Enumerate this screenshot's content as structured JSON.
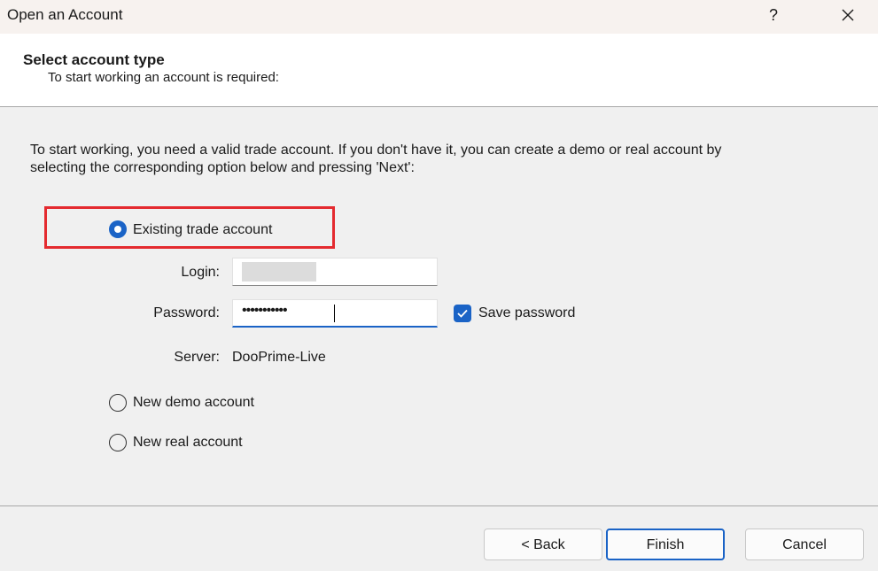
{
  "window": {
    "title": "Open an Account",
    "help_label": "?",
    "close_label": "✕"
  },
  "header": {
    "title": "Select account type",
    "subtitle": "To start working an account is required:"
  },
  "intro": {
    "line1": "To start working, you need a valid trade account. If you don't have it, you can create a demo or real account by",
    "line2": "selecting the corresponding option below and pressing 'Next':"
  },
  "options": {
    "existing": {
      "label": "Existing trade account",
      "selected": true
    },
    "demo": {
      "label": "New demo account",
      "selected": false
    },
    "real": {
      "label": "New real account",
      "selected": false
    }
  },
  "form": {
    "login_label": "Login:",
    "login_value": "",
    "password_label": "Password:",
    "password_value": "•••••••••••",
    "save_password_label": "Save password",
    "save_password_checked": true,
    "server_label": "Server:",
    "server_value": "DooPrime-Live"
  },
  "buttons": {
    "back": "< Back",
    "finish": "Finish",
    "cancel": "Cancel"
  },
  "colors": {
    "accent": "#1a63c6",
    "highlight": "#e42a2f"
  }
}
